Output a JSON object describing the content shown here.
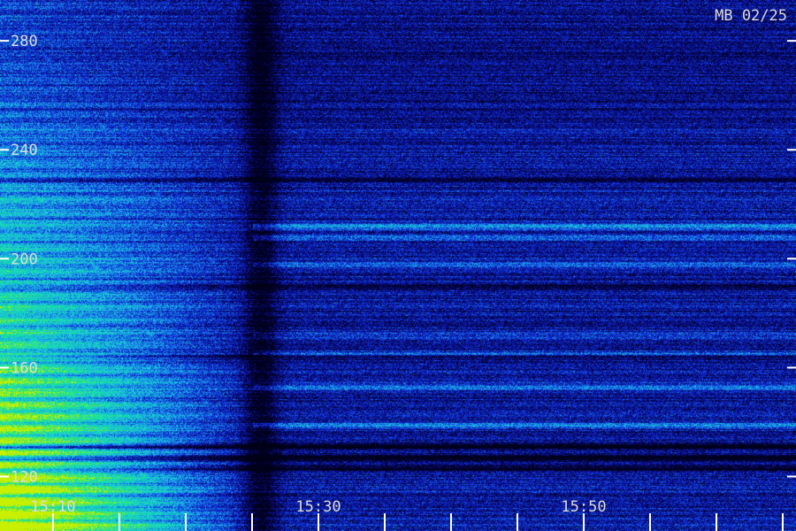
{
  "chart_data": {
    "type": "heatmap",
    "title": "MB 02/25",
    "xlabel": "",
    "ylabel": "",
    "x_ticks": [
      {
        "label": "15:10",
        "minutes": 10
      },
      {
        "label": "15:30",
        "minutes": 30
      },
      {
        "label": "15:50",
        "minutes": 50
      }
    ],
    "x_range_minutes": [
      6,
      66
    ],
    "x_minor_step_minutes": 5,
    "y_ticks": [
      120,
      160,
      200,
      240,
      280
    ],
    "y_range": [
      100,
      295
    ],
    "grid": false,
    "legend": "none",
    "colormap": [
      "#000018",
      "#0a0a80",
      "#1030e0",
      "#1a9ae6",
      "#19d6d6",
      "#10e880",
      "#c8f000"
    ],
    "burst_end_minutes": 25,
    "bright_bands": [
      {
        "freq": 212,
        "level": 0.35
      },
      {
        "freq": 208,
        "level": 0.3
      },
      {
        "freq": 198,
        "level": 0.22
      },
      {
        "freq": 172,
        "level": 0.2
      },
      {
        "freq": 165,
        "level": 0.28
      },
      {
        "freq": 153,
        "level": 0.25
      },
      {
        "freq": 139,
        "level": 0.3
      }
    ],
    "dark_bands": [
      {
        "freq": 190,
        "level": 0.5
      },
      {
        "freq": 164,
        "level": 0.4
      },
      {
        "freq": 131,
        "level": 0.6
      },
      {
        "freq": 127,
        "level": 0.7
      },
      {
        "freq": 123,
        "level": 0.5
      },
      {
        "freq": 229,
        "level": 0.4
      }
    ]
  }
}
